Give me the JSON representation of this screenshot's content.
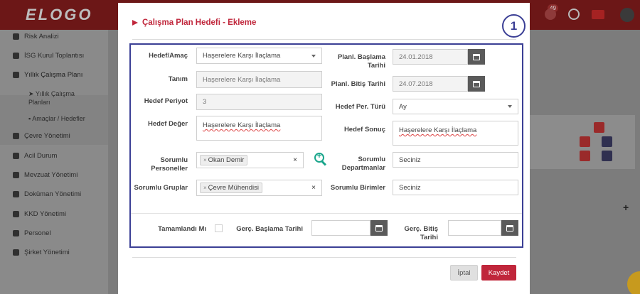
{
  "app": {
    "logo": "ELOGO",
    "notification_count": "49",
    "accent_color": "#c0263b",
    "highlight_color": "#3b3f95"
  },
  "sidebar": {
    "items": [
      {
        "label": "Risk Analizi",
        "icon": "risk-icon"
      },
      {
        "label": "İSG Kurul Toplantısı",
        "icon": "user-icon"
      },
      {
        "label": "Yıllık Çalışma Planı",
        "icon": "check-square-icon"
      },
      {
        "label": "Çevre Yönetimi",
        "icon": "building-icon"
      },
      {
        "label": "Acil Durum",
        "icon": "alarm-icon"
      },
      {
        "label": "Mevzuat Yönetimi",
        "icon": "info-icon"
      },
      {
        "label": "Doküman Yönetimi",
        "icon": "folder-icon"
      },
      {
        "label": "KKD Yönetimi",
        "icon": "tags-icon"
      },
      {
        "label": "Personel",
        "icon": "users-icon"
      },
      {
        "label": "Şirket Yönetimi",
        "icon": "chart-icon"
      }
    ],
    "subitems": [
      {
        "label": "Yıllık Çalışma Planları"
      },
      {
        "label": "Amaçlar / Hedefler"
      }
    ]
  },
  "modal": {
    "title": "Çalışma Plan Hedefi - Ekleme",
    "step_number": "1",
    "fields": {
      "hedef_amac": {
        "label": "Hedef/Amaç",
        "value": "Haşerelere Karşı İlaçlama"
      },
      "tanim": {
        "label": "Tanım",
        "value": "Haşerelere Karşı İlaçlama"
      },
      "hedef_periyot": {
        "label": "Hedef Periyot",
        "value": "3"
      },
      "hedef_deger": {
        "label": "Hedef Değer",
        "value": "Haşerelere Karşı İlaçlama"
      },
      "sorumlu_personeller": {
        "label": "Sorumlu Personeller",
        "tag": "Okan Demir"
      },
      "sorumlu_gruplar": {
        "label": "Sorumlu Gruplar",
        "tag": "Çevre Mühendisi"
      },
      "planli_baslama": {
        "label": "Planl. Başlama Tarihi",
        "value": "24.01.2018"
      },
      "planli_bitis": {
        "label": "Planl. Bitiş Tarihi",
        "value": "24.07.2018"
      },
      "hedef_per_turu": {
        "label": "Hedef Per. Türü",
        "value": "Ay"
      },
      "hedef_sonuc": {
        "label": "Hedef Sonuç",
        "value": "Haşerelere Karşı İlaçlama"
      },
      "sorumlu_departmanlar": {
        "label": "Sorumlu Departmanlar",
        "placeholder": "Seciniz"
      },
      "sorumlu_birimler": {
        "label": "Sorumlu Birimler",
        "placeholder": "Seciniz"
      },
      "tamamlandi": {
        "label": "Tamamlandı Mı"
      },
      "gerc_baslama": {
        "label": "Gerç. Başlama Tarihi",
        "value": ""
      },
      "gerc_bitis": {
        "label": "Gerç. Bitiş Tarihi",
        "value": ""
      }
    },
    "buttons": {
      "cancel": "İptal",
      "save": "Kaydet"
    }
  }
}
